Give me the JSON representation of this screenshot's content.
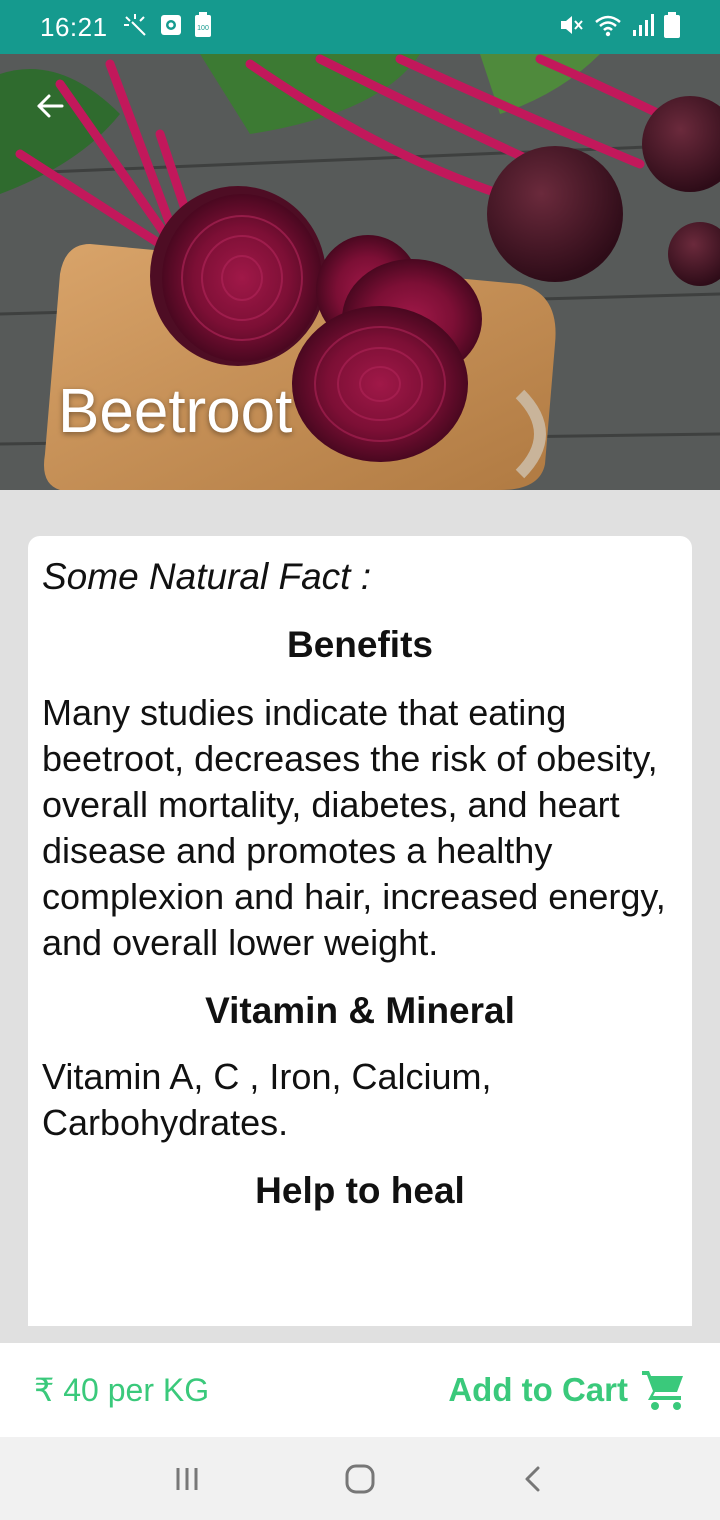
{
  "status_bar": {
    "time": "16:21",
    "left_icons": [
      "brightness-auto-icon",
      "screen-record-icon",
      "battery-saver-icon"
    ],
    "right_icons": [
      "mute-icon",
      "wifi-icon",
      "signal-icon",
      "battery-icon"
    ]
  },
  "hero": {
    "title": "Beetroot",
    "back_icon": "arrow-left-icon"
  },
  "content": {
    "fact_label": "Some Natural Fact :",
    "sections": [
      {
        "heading": "Benefits",
        "text": "Many studies indicate that eating beetroot, decreases the risk of obesity, overall mortality, diabetes, and heart disease and promotes a healthy complexion and hair, increased energy, and overall lower weight."
      },
      {
        "heading": "Vitamin & Mineral",
        "text": "Vitamin A, C , Iron, Calcium, Carbohydrates."
      },
      {
        "heading": "Help to heal",
        "text": ""
      }
    ]
  },
  "bottom_bar": {
    "price": "₹ 40 per KG",
    "cart_label": "Add to Cart",
    "cart_icon": "shopping-cart-icon"
  },
  "nav_bar": {
    "icons": [
      "recent-apps-icon",
      "home-icon",
      "back-icon"
    ]
  },
  "colors": {
    "status_bar": "#159a8e",
    "accent_green": "#3ac97b",
    "background": "#e0e0e0"
  }
}
